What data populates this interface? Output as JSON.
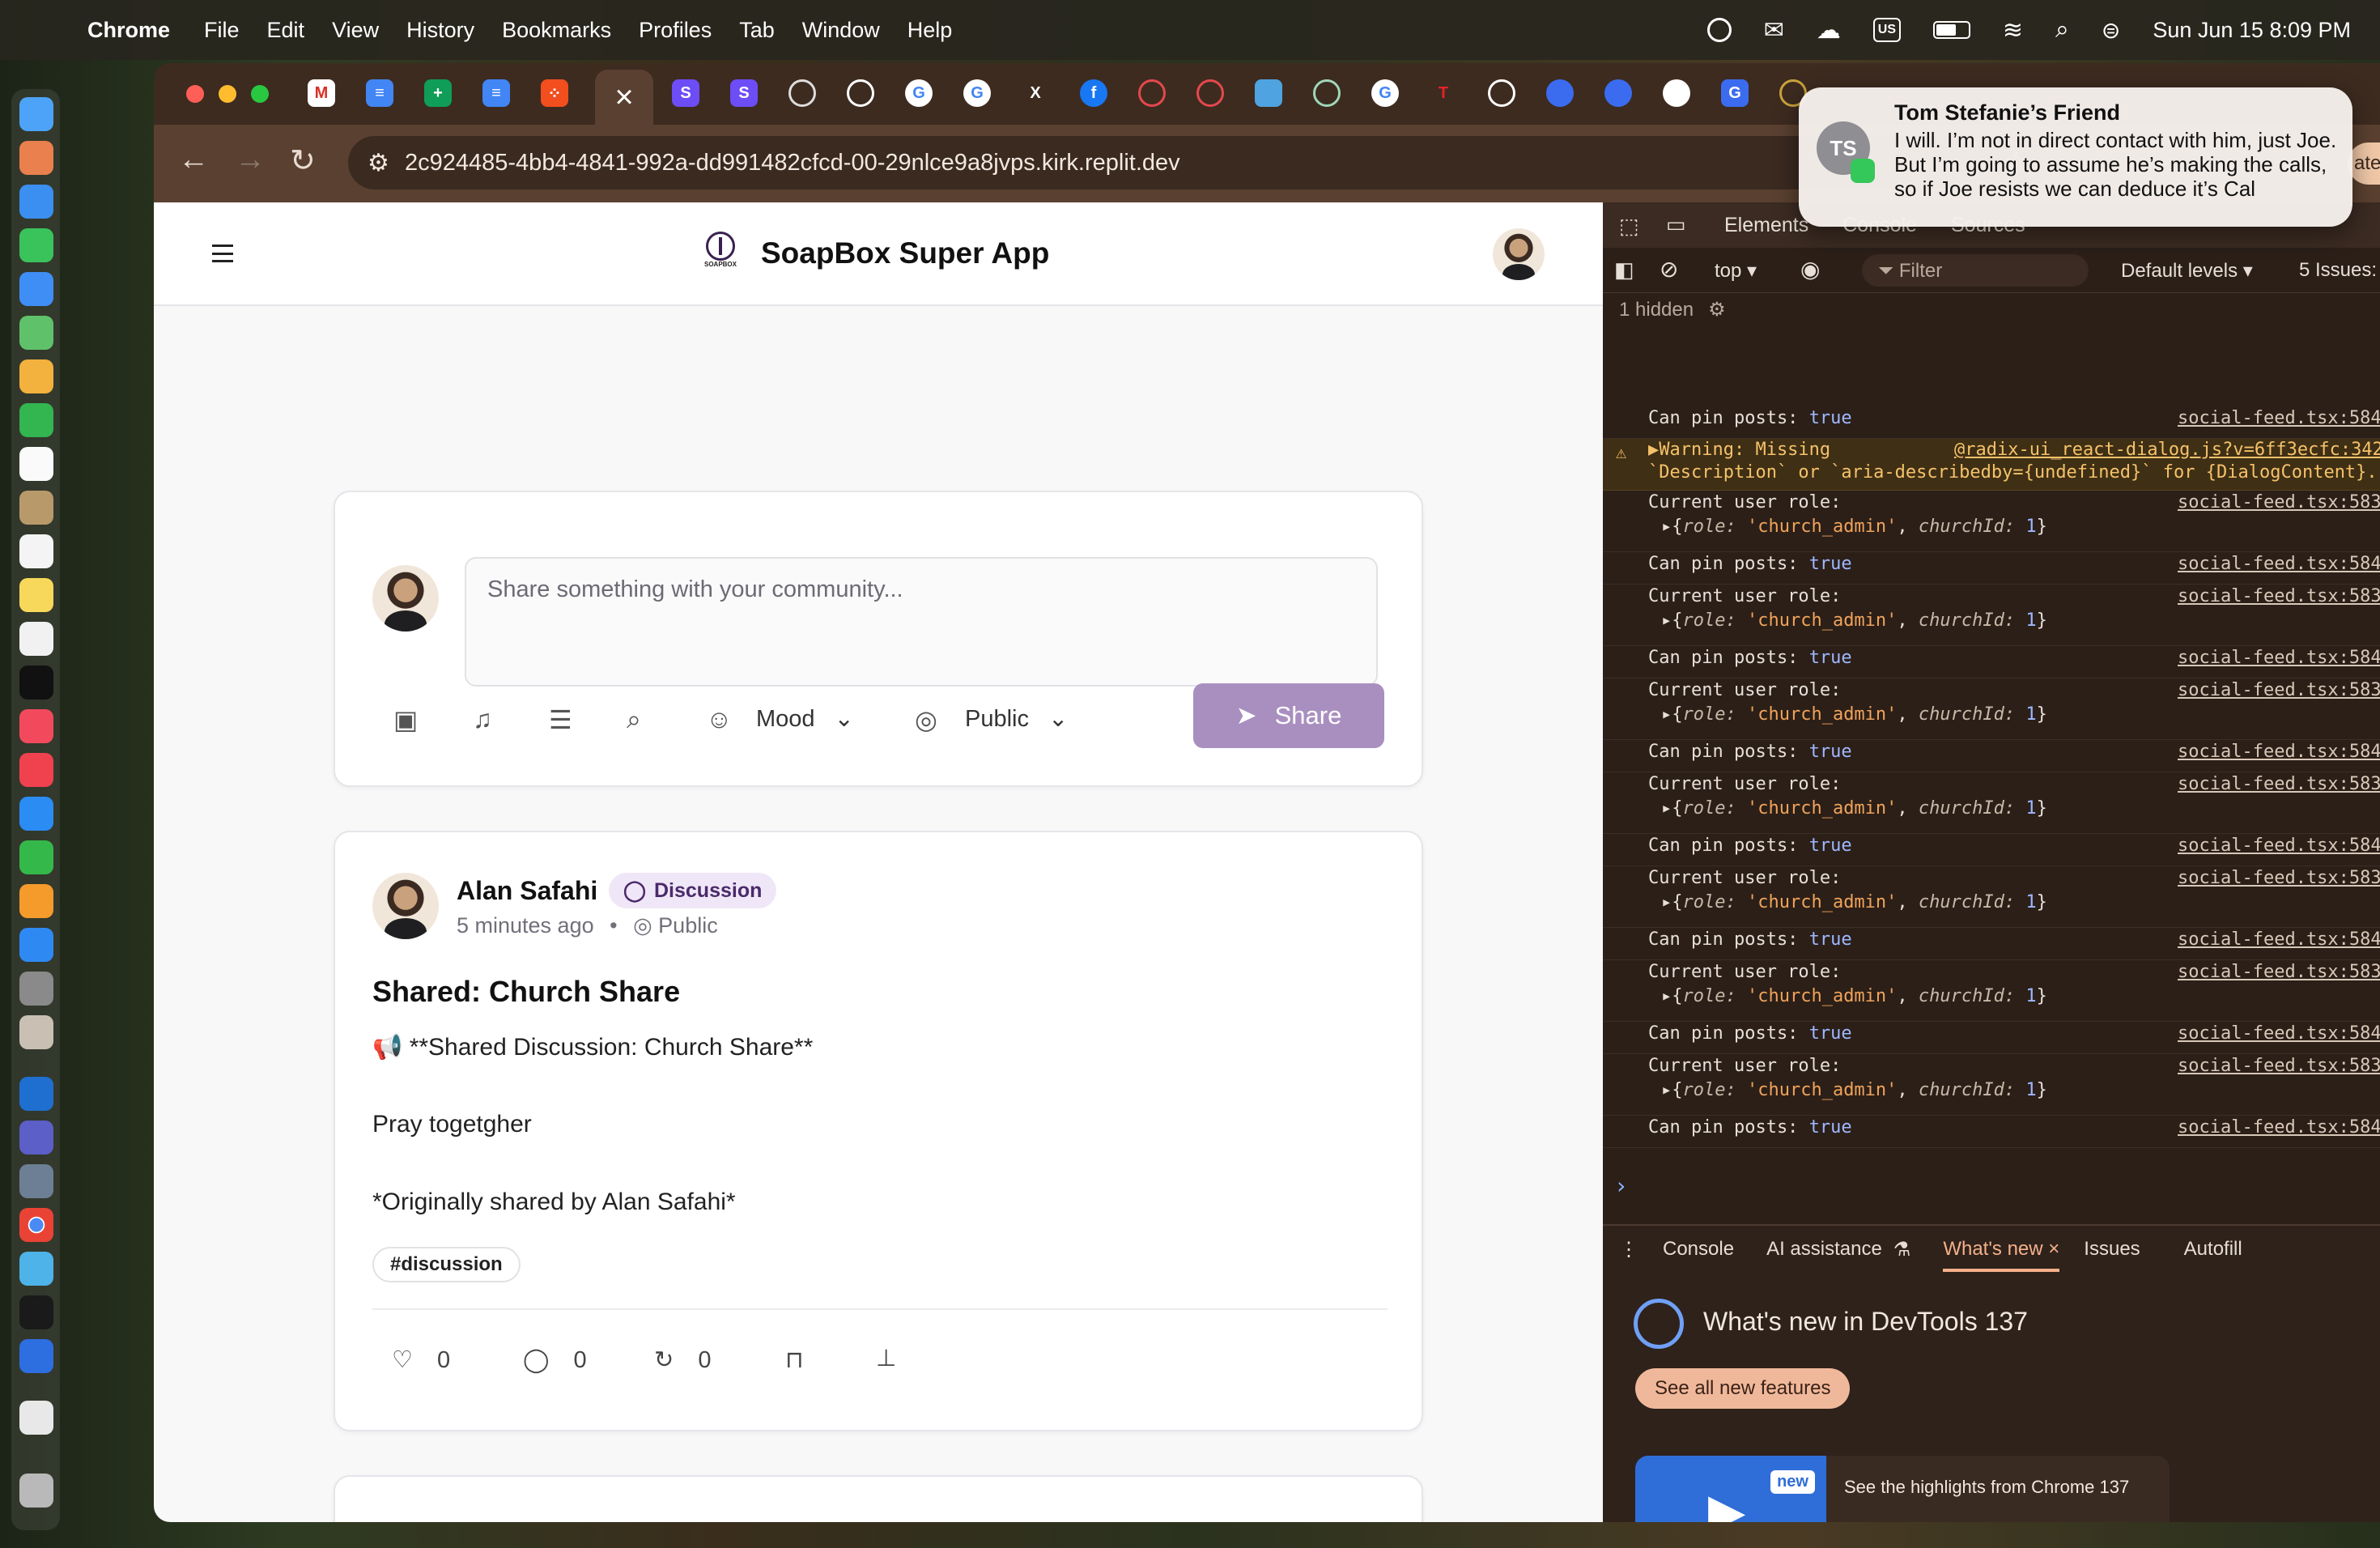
{
  "menubar": {
    "app": "Chrome",
    "items": [
      "File",
      "Edit",
      "View",
      "History",
      "Bookmarks",
      "Profiles",
      "Tab",
      "Window",
      "Help"
    ],
    "input_source": "US",
    "datetime": "Sun Jun 15  8:09 PM"
  },
  "browser": {
    "url": "2c924485-4bb4-4841-992a-dd991482cfcd-00-29nlce9a8jvps.kirk.replit.dev",
    "active_tab_close": "×",
    "cut_off_button": "ate"
  },
  "notification": {
    "initials": "TS",
    "title": "Tom Stefanie’s Friend",
    "body": "I will. I’m not in direct contact with him, just Joe. But I’m going to assume he’s making the calls, so if Joe resists we can deduce it’s Cal"
  },
  "app": {
    "title": "SoapBox Super App",
    "logo_text": "SOAPBOX",
    "composer": {
      "placeholder": "Share something with your community...",
      "mood_label": "Mood",
      "visibility_label": "Public",
      "share_label": "Share"
    },
    "post": {
      "author": "Alan Safahi",
      "badge": "Discussion",
      "time": "5 minutes ago",
      "separator": "•",
      "visibility": "Public",
      "title": "Shared: Church Share",
      "line1": "📢 **Shared Discussion: Church Share**",
      "line2": "Pray togetgher",
      "line3": "*Originally shared by Alan Safahi*",
      "tag": "#discussion",
      "likes": "0",
      "comments": "0",
      "reposts": "0"
    }
  },
  "devtools": {
    "tabs": [
      "Elements",
      "Console",
      "Sources"
    ],
    "context": "top",
    "filter_placeholder": "Filter",
    "levels": "Default levels",
    "issues": "5 Issues:",
    "hidden": "1 hidden",
    "warning": {
      "line1": "▶Warning: Missing",
      "link": "@radix-ui_react-dialog.js?v=6ff3ecfc:342",
      "line2": "`Description` or `aria-describedby={undefined}` for {DialogContent}."
    },
    "pin_text": "Can pin posts:",
    "pin_value": "true",
    "role_text": "Current user role:",
    "role_obj": {
      "open": "▸{",
      "role_key": "role:",
      "role_val": "'church_admin'",
      "church_key": "churchId:",
      "church_val": "1",
      "close": "}"
    },
    "src_pin": "social-feed.tsx:584",
    "src_role": "social-feed.tsx:583",
    "prompt": "›",
    "drawer_tabs": [
      "Console",
      "AI assistance",
      "What's new",
      "Issues",
      "Autofill"
    ],
    "whats_new_title": "What's new in DevTools 137",
    "see_all": "See all new features",
    "video_badge": "new",
    "highlights": "See the highlights from Chrome 137"
  }
}
